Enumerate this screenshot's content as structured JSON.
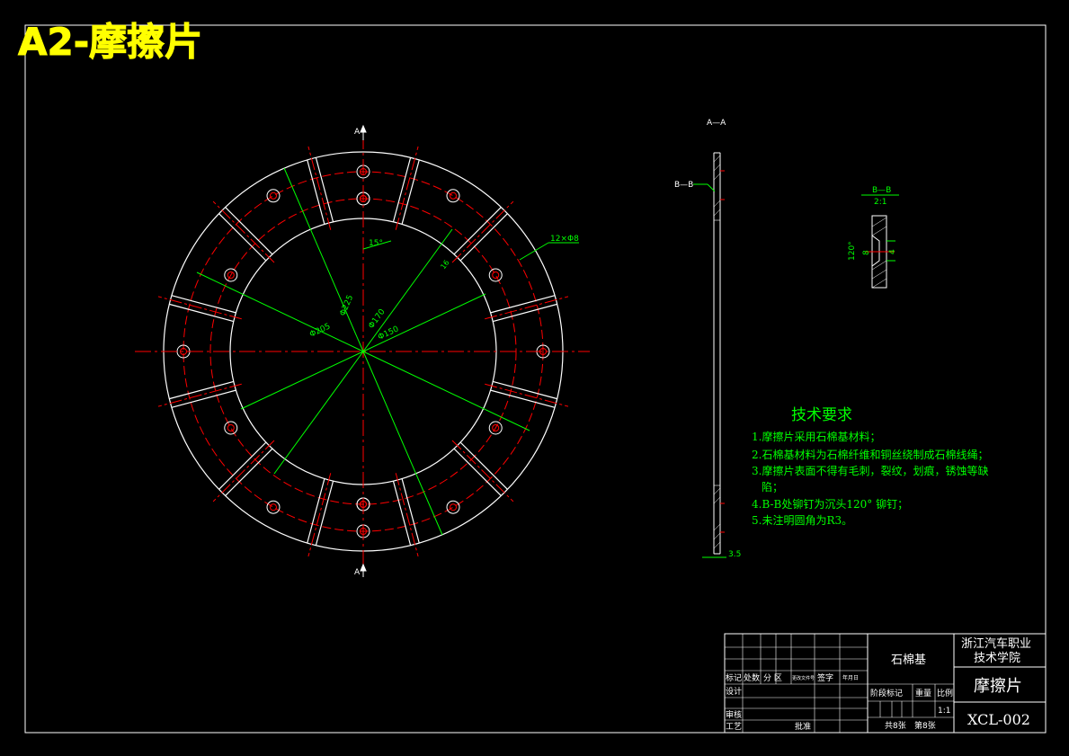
{
  "title": "A2-摩擦片",
  "main_view": {
    "section_mark_top": "A",
    "section_mark_bottom": "A",
    "dim_hole_spec": "12×Φ8",
    "dim_angle": "15°",
    "dim_d225": "Φ225",
    "dim_d205": "Φ205",
    "dim_d170": "Φ170",
    "dim_d150": "Φ150",
    "dim_small": "16"
  },
  "section_view": {
    "label": "A—A",
    "bb_mark": "B—B",
    "thickness_dim": "3.5"
  },
  "detail_view": {
    "label": "B—B",
    "scale": "2:1",
    "angle": "120°",
    "dim_8": "8",
    "dim_4": "4"
  },
  "tech": {
    "heading": "技术要求",
    "req1": "1.摩擦片采用石棉基材料；",
    "req2": "2.石棉基材料为石棉纤维和铜丝绕制成石棉线绳；",
    "req3a": "3.摩擦片表面不得有毛刺，裂纹，划痕，锈蚀等缺",
    "req3b": "陷；",
    "req4": "4.B-B处铆钉为沉头120° 铆钉；",
    "req5": "5.未注明圆角为R3。"
  },
  "title_block": {
    "material": "石棉基",
    "school_line1": "浙江汽车职业",
    "school_line2": "技术学院",
    "part_name": "摩擦片",
    "drawing_no": "XCL-002",
    "col_mark": "标记",
    "col_count": "处数",
    "col_zone": "分 区",
    "col_docno": "更改文件号",
    "col_sign": "签字",
    "col_date": "年月日",
    "designer_label": "设计",
    "checker_label": "审核",
    "process_label": "工艺",
    "approve_label": "批准",
    "stage_label": "阶段标记",
    "weight_label": "重量",
    "scale_label": "比例",
    "scale_value": "1:1",
    "sheets_total": "共8张",
    "sheet_no": "第8张"
  },
  "colors": {
    "background": "#000000",
    "outline": "#ffffff",
    "centerline": "#ff0000",
    "dimension": "#00ff00",
    "title": "#ffff00",
    "text": "#00ff00"
  }
}
